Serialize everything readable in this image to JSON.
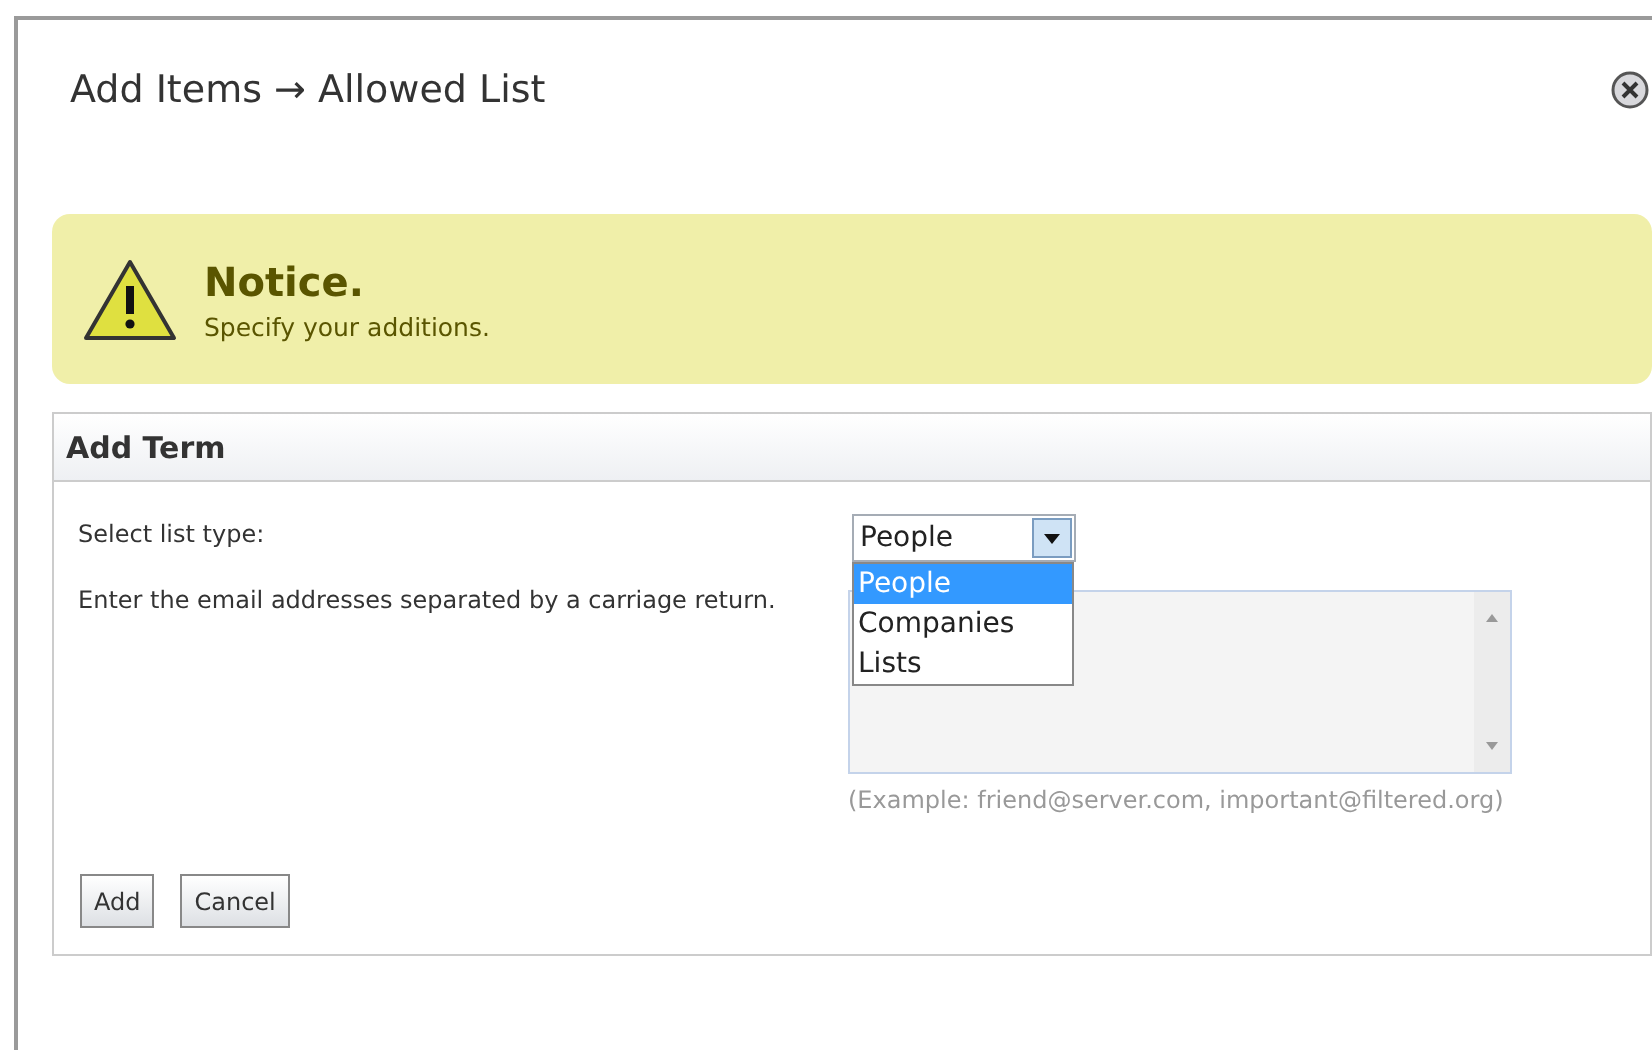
{
  "window": {
    "title": "Add Items → Allowed List"
  },
  "notice": {
    "title": "Notice.",
    "message": "Specify your additions."
  },
  "panel": {
    "title": "Add Term",
    "list_type": {
      "label": "Select list type:",
      "value": "People",
      "expanded": true,
      "options": [
        {
          "label": "People",
          "selected": true
        },
        {
          "label": "Companies",
          "selected": false
        },
        {
          "label": "Lists",
          "selected": false
        }
      ]
    },
    "emails": {
      "label": "Enter the email addresses separated by a carriage return.",
      "hint": "(Example: friend@server.com, important@filtered.org)"
    },
    "buttons": [
      "Add",
      "Cancel"
    ]
  }
}
